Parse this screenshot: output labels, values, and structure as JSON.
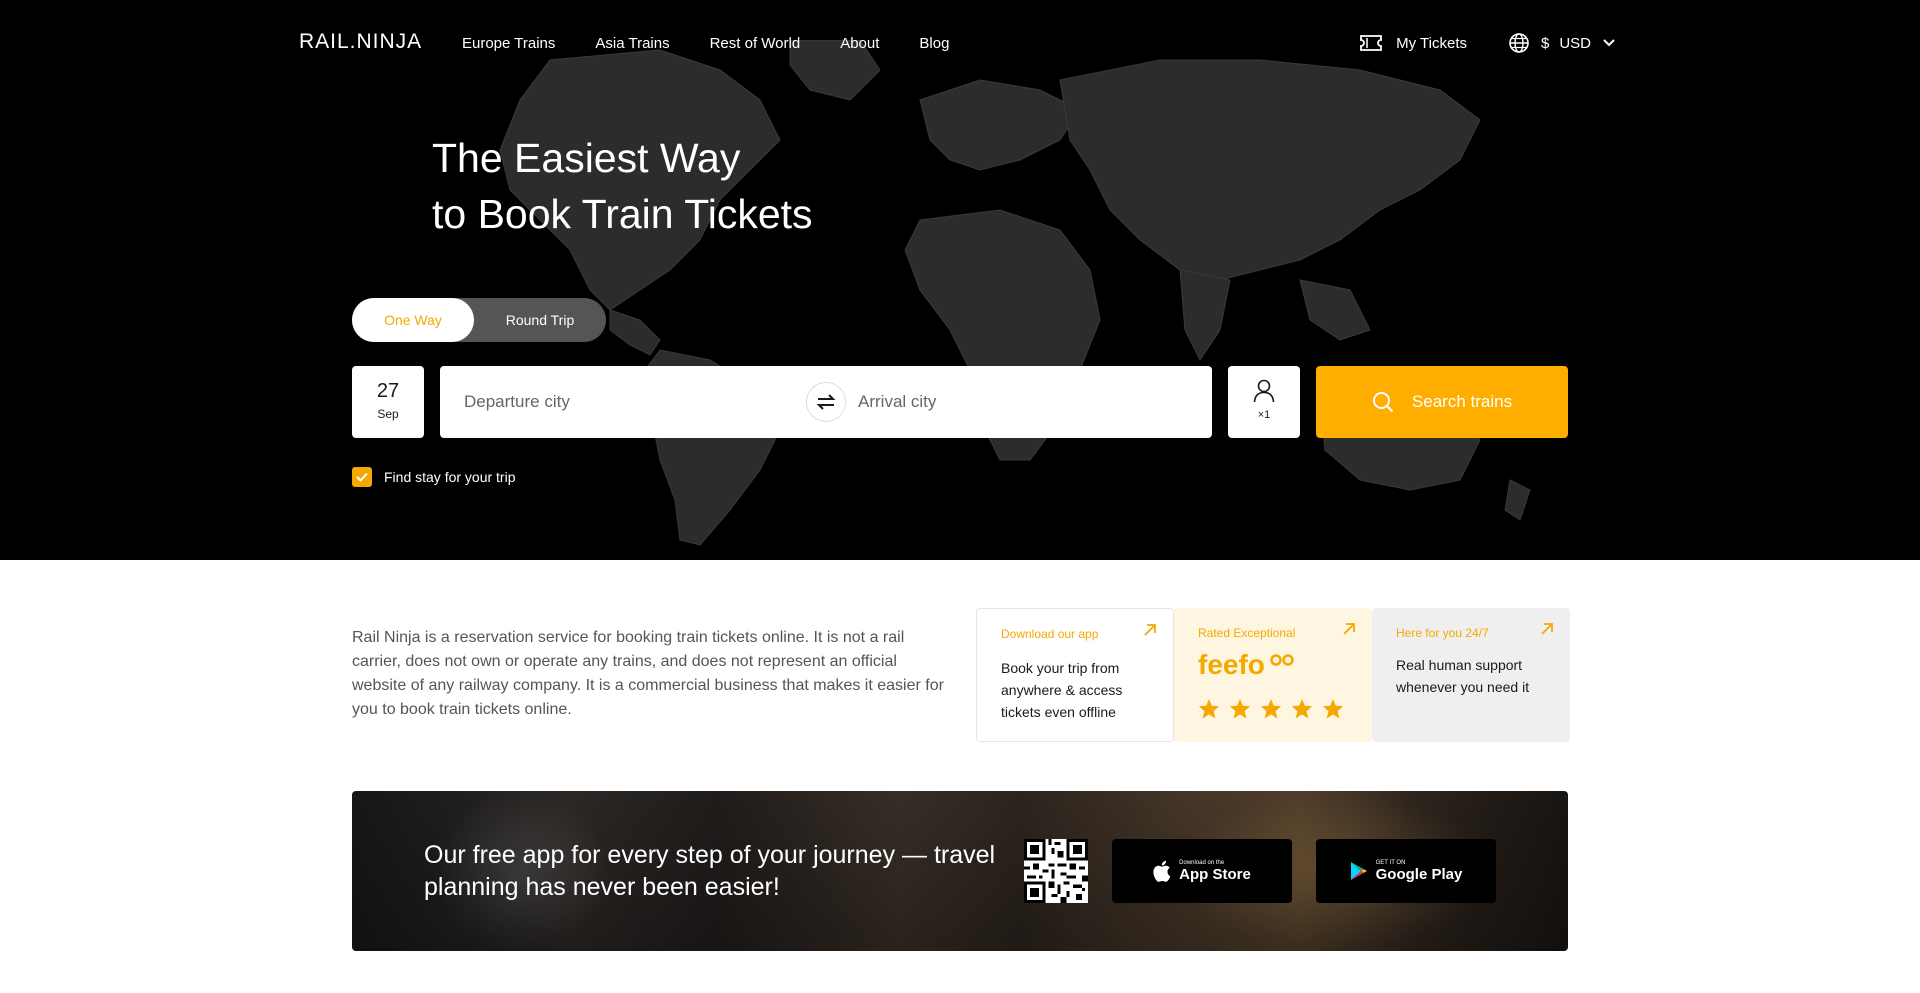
{
  "nav": {
    "logo": "RAIL.NINJA",
    "links": [
      "Europe Trains",
      "Asia Trains",
      "Rest of World",
      "About",
      "Blog"
    ],
    "my_tickets": "My Tickets",
    "currency_symbol": "$",
    "currency_code": "USD"
  },
  "hero": {
    "headline_line1": "The Easiest Way",
    "headline_line2": "to Book Train Tickets"
  },
  "search": {
    "trip_types": [
      "One Way",
      "Round Trip"
    ],
    "selected_trip_type": "One Way",
    "date_day": "27",
    "date_month": "Sep",
    "departure_placeholder": "Departure city",
    "departure_value": "",
    "arrival_placeholder": "Arrival city",
    "arrival_value": "",
    "passengers": "×1",
    "search_label": "Search trains",
    "stay_label": "Find stay for your trip",
    "stay_checked": true
  },
  "info": {
    "disclaimer": "Rail Ninja is a reservation service for booking train tickets online. It is not a rail carrier, does not own or operate any trains, and does not represent an official website of any railway company. It is a commercial business that makes it easier for you to book train tickets online.",
    "cards": [
      {
        "title": "Download our app",
        "text": "Book your trip from anywhere & access tickets even offline"
      },
      {
        "title": "Rated Exceptional",
        "logo": "feefo",
        "stars": 5
      },
      {
        "title": "Here for you 24/7",
        "text": "Real human support whenever you need it"
      }
    ]
  },
  "banner": {
    "text": "Our free app for every step of your journey — travel planning has never been easier!",
    "appstore_small": "Download on the",
    "appstore_big": "App Store",
    "gplay_small": "GET IT ON",
    "gplay_big": "Google Play"
  },
  "colors": {
    "accent": "#ffae00",
    "hero_bg": "#000000",
    "card_rated_bg": "#fff6e2",
    "card_support_bg": "#efefef"
  }
}
